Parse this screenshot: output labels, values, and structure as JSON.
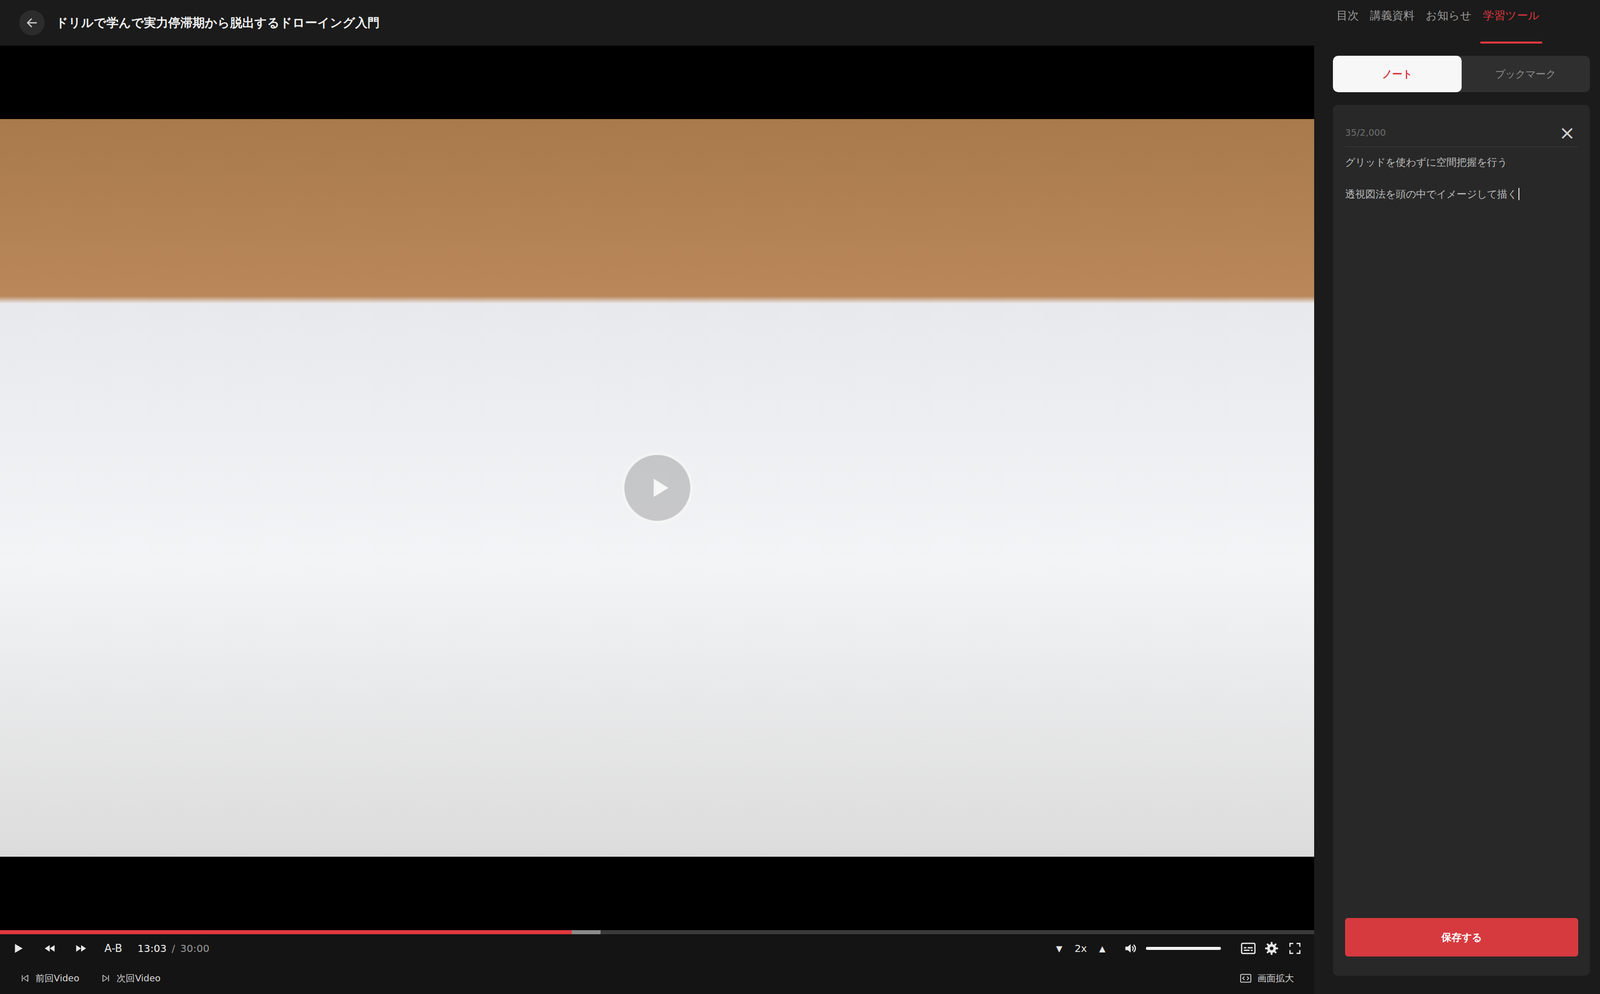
{
  "window": {
    "title": "ドリルで学んで実力停滞期から脱出するドローイング入門"
  },
  "side_tabs": [
    {
      "label": "目次",
      "selected": false
    },
    {
      "label": "講義資料",
      "selected": false
    },
    {
      "label": "お知らせ",
      "selected": false
    },
    {
      "label": "学習ツール",
      "selected": true
    }
  ],
  "mode_tabs": [
    {
      "label": "ノート",
      "selected": true
    },
    {
      "label": "ブックマーク",
      "selected": false
    }
  ],
  "note": {
    "counter": "35/2,000",
    "close": "×",
    "lines": [
      "グリッドを使わずに空間把握を行う",
      "透視図法を頭の中でイメージして描く"
    ],
    "focused": true,
    "save": "保存する"
  },
  "player": {
    "paused": true,
    "current": "13:03",
    "separator": "/",
    "duration": "30:00",
    "progress": {
      "level": 0.435,
      "buffered": 0.457
    },
    "ab_repeat": "A-B",
    "speed": {
      "down": "▼",
      "value": "2x",
      "up": "▲"
    },
    "volume": {
      "level": 1,
      "muted": false
    }
  },
  "footer": {
    "prev": "前回Video",
    "next": "次回Video",
    "zoom": "画面拡大"
  }
}
